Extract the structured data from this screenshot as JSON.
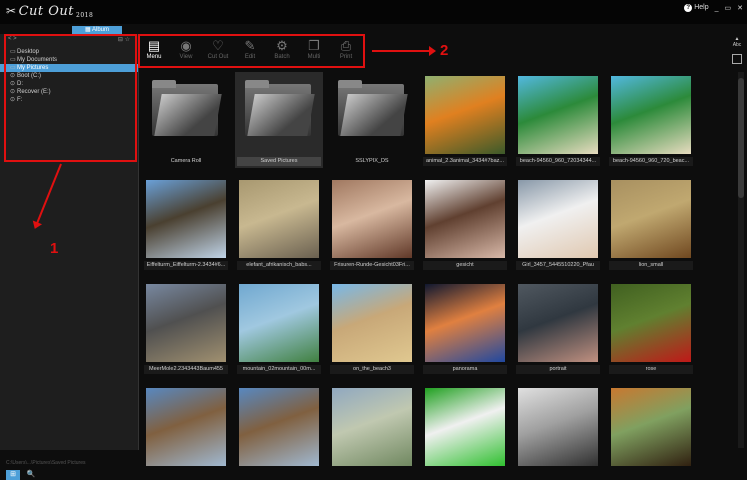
{
  "app": {
    "logo_text": "Cut Out",
    "logo_year": "2018",
    "active_tab": "Album"
  },
  "window_controls": {
    "help_label": "Help",
    "minimize": "_",
    "restore": "▭",
    "close": "✕"
  },
  "sidebar": {
    "header_left": "< >",
    "header_right": "⊟ ☆",
    "items": [
      {
        "label": "Desktop",
        "icon": "folder-icon"
      },
      {
        "label": "My Documents",
        "icon": "folder-icon"
      },
      {
        "label": "My Pictures",
        "icon": "folder-icon",
        "selected": true
      },
      {
        "label": "Boot (C:)",
        "icon": "drive-icon"
      },
      {
        "label": "D:",
        "icon": "drive-icon"
      },
      {
        "label": "Recover (E:)",
        "icon": "drive-icon"
      },
      {
        "label": "F:",
        "icon": "drive-icon"
      }
    ],
    "status_path": "C:\\Users\\...\\Pictures\\Saved Pictures",
    "bottom_buttons": [
      "⊞",
      "🔍"
    ]
  },
  "toolbar": {
    "tools": [
      {
        "label": "Menu",
        "icon": "menu-icon",
        "glyph": "▤",
        "active": true
      },
      {
        "label": "View",
        "icon": "eye-icon",
        "glyph": "◉"
      },
      {
        "label": "Cut Out",
        "icon": "heart-icon",
        "glyph": "♡"
      },
      {
        "label": "Edit",
        "icon": "brush-icon",
        "glyph": "✎"
      },
      {
        "label": "Batch",
        "icon": "gear-icon",
        "glyph": "⚙"
      },
      {
        "label": "Multi",
        "icon": "stack-icon",
        "glyph": "❐"
      },
      {
        "label": "Print",
        "icon": "print-icon",
        "glyph": "⎙"
      }
    ]
  },
  "annotations": {
    "box1_number": "1",
    "box2_number": "2"
  },
  "right_panel": {
    "label": "Abc"
  },
  "grid": {
    "items": [
      {
        "caption": "Camera Roll",
        "type": "folder"
      },
      {
        "caption": "Saved Pictures",
        "type": "folder",
        "selected": true
      },
      {
        "caption": "SSLYPIX_DS",
        "type": "folder"
      },
      {
        "caption": "animal_2.3animal_3434#7baz...",
        "type": "photo",
        "colors": [
          "#8fb070",
          "#3c5a2a",
          "#e08020"
        ]
      },
      {
        "caption": "beach-94560_960_72034344...",
        "type": "photo",
        "colors": [
          "#52b8e0",
          "#e8dcc0",
          "#2c8a3a"
        ]
      },
      {
        "caption": "beach-94560_960_720_beac...",
        "type": "photo",
        "colors": [
          "#52b8e0",
          "#e8dcc0",
          "#2c8a3a"
        ]
      },
      {
        "caption": "Eiffelturm_Eiffelturm-2.3434#6...",
        "type": "photo",
        "colors": [
          "#6aa0d8",
          "#c0d4e8",
          "#4a4030"
        ]
      },
      {
        "caption": "elefant_afrikanisch_babs...",
        "type": "photo",
        "colors": [
          "#a89870",
          "#6a6050",
          "#c8b890"
        ]
      },
      {
        "caption": "Frisuren-Runde-Gesicht03Fri...",
        "type": "photo",
        "colors": [
          "#a07860",
          "#603828",
          "#d8b8a0"
        ]
      },
      {
        "caption": "gesicht",
        "type": "photo",
        "colors": [
          "#f0f0f0",
          "#d8b8a8",
          "#604030"
        ]
      },
      {
        "caption": "Girl_3457_5445510220_Pfau",
        "type": "photo",
        "colors": [
          "#8898a8",
          "#e0c8b0",
          "#f0f0f0"
        ]
      },
      {
        "caption": "lion_small",
        "type": "photo",
        "colors": [
          "#a89060",
          "#704820",
          "#c0a870"
        ]
      },
      {
        "caption": "MeerMole2.2343443Baum455",
        "type": "photo",
        "colors": [
          "#7888a0",
          "#a09070",
          "#505050"
        ]
      },
      {
        "caption": "mountain_02mountain_00m...",
        "type": "photo",
        "colors": [
          "#70a8d0",
          "#408040",
          "#a0c8e0"
        ]
      },
      {
        "caption": "on_the_beach3",
        "type": "photo",
        "colors": [
          "#78b8e8",
          "#e0c890",
          "#c8a878"
        ]
      },
      {
        "caption": "panorama",
        "type": "photo",
        "colors": [
          "#101830",
          "#2048a0",
          "#e08040"
        ]
      },
      {
        "caption": "portrait",
        "type": "photo",
        "colors": [
          "#505860",
          "#c09080",
          "#303840"
        ]
      },
      {
        "caption": "rose",
        "type": "photo",
        "colors": [
          "#406020",
          "#c01818",
          "#608030"
        ]
      },
      {
        "caption": "",
        "type": "photo",
        "colors": [
          "#5888c0",
          "#a0b8d0",
          "#806040"
        ]
      },
      {
        "caption": "",
        "type": "photo",
        "colors": [
          "#5888c0",
          "#a0b8d0",
          "#806040"
        ]
      },
      {
        "caption": "",
        "type": "photo",
        "colors": [
          "#90a8c0",
          "#708860",
          "#c0c8b0"
        ]
      },
      {
        "caption": "",
        "type": "photo",
        "colors": [
          "#20a020",
          "#30c030",
          "#f0f0f0"
        ]
      },
      {
        "caption": "",
        "type": "photo",
        "colors": [
          "#e0e0e0",
          "#303030",
          "#a0a0a0"
        ]
      },
      {
        "caption": "",
        "type": "photo",
        "colors": [
          "#c87830",
          "#302010",
          "#80a060"
        ]
      }
    ]
  }
}
